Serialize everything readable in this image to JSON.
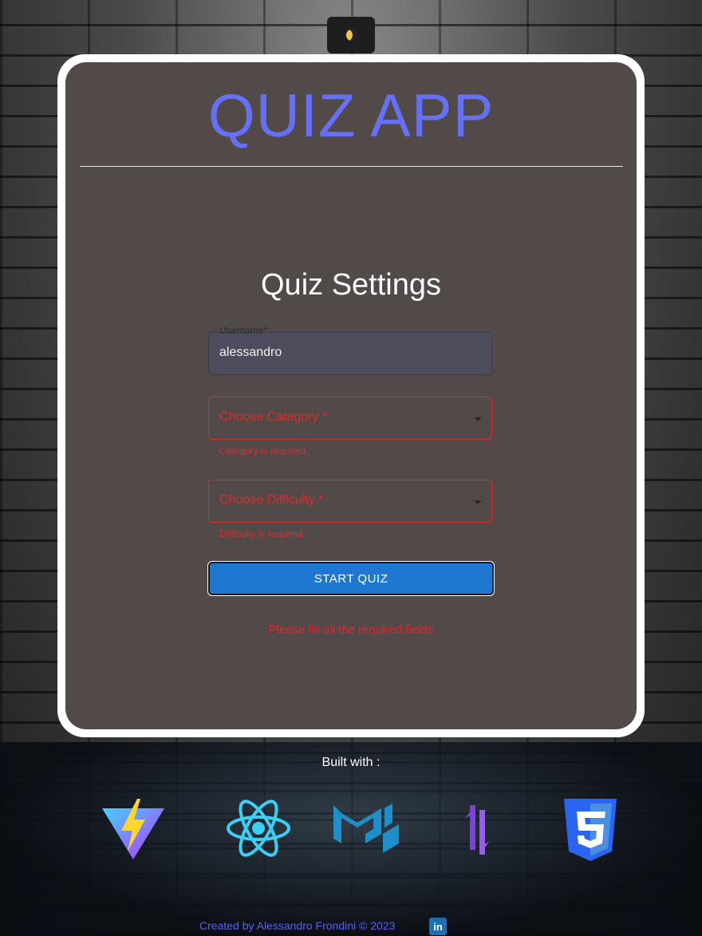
{
  "header": {
    "theme_toggle_icon": "moon-icon"
  },
  "card": {
    "app_title": "QUIZ APP",
    "settings_title": "Quiz Settings",
    "username": {
      "label": "Username",
      "required_mark": "*",
      "value": "alessandro"
    },
    "category": {
      "placeholder": "Choose Category",
      "required_mark": "*",
      "helper": "Category is required."
    },
    "difficulty": {
      "placeholder": "Choose Difficulty",
      "required_mark": "*",
      "helper": "Difficulty is required."
    },
    "start_button": "START QUIZ",
    "error_message": "Please fill all the required fields"
  },
  "footer": {
    "built_with": "Built with :",
    "tech_icons": [
      "vite-icon",
      "react-icon",
      "mui-icon",
      "zustand-icon",
      "css3-icon"
    ],
    "credit": "Created by Alessandro Frondini © 2023",
    "linkedin_label": "in"
  },
  "colors": {
    "accent": "#6670f5",
    "card_bg": "#524a48",
    "error": "#d32f2f",
    "button": "#1e78d2"
  }
}
